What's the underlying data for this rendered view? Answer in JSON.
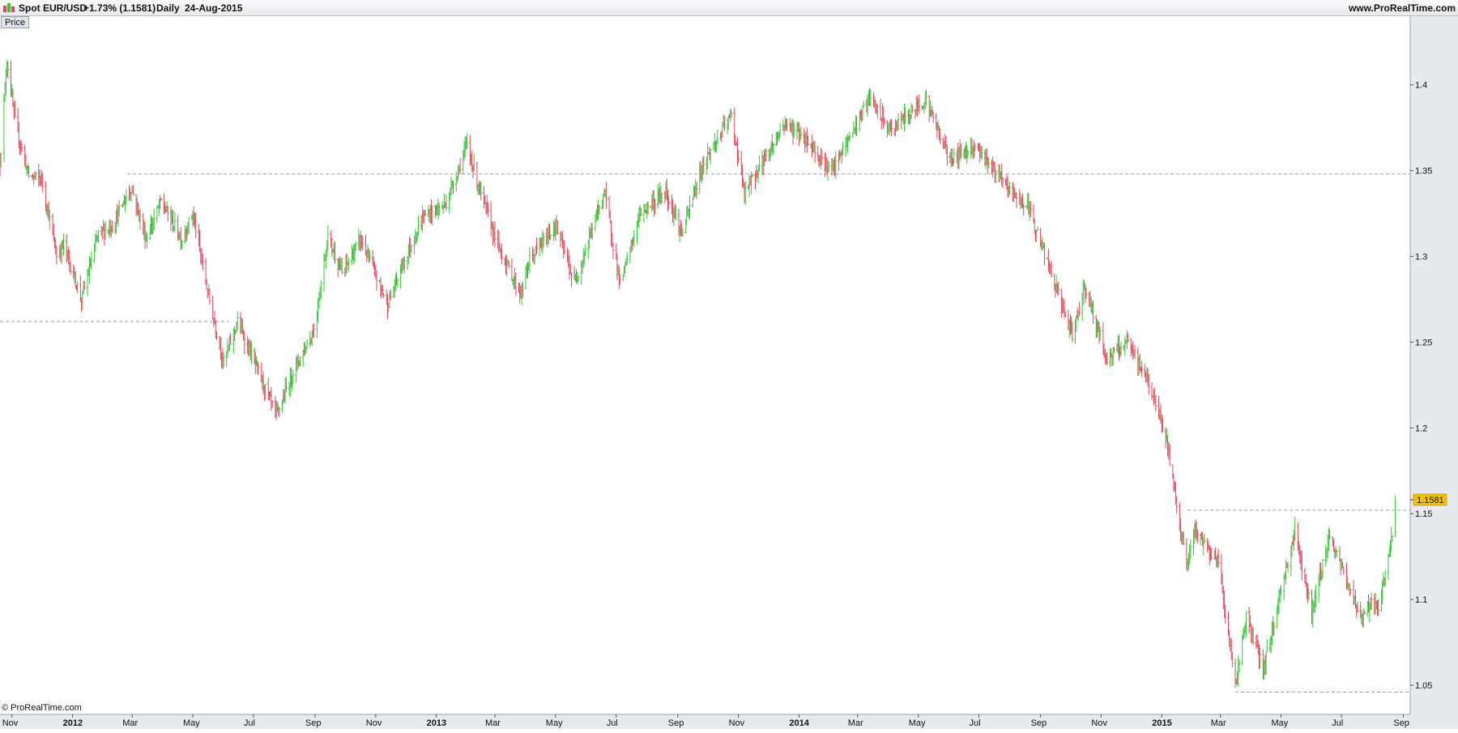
{
  "header": {
    "symbol": "Spot EUR/USD",
    "change": "+1.73% (1.1581)",
    "period": "Daily",
    "date": "24-Aug-2015",
    "brand": "www.ProRealTime.com",
    "panel_label": "Price",
    "copyright": "© ProRealTime.com"
  },
  "colors": {
    "up": "#38c438",
    "down": "#e0485a",
    "last_price_bg": "#f2c200",
    "axis_bg": "#e6e9ee",
    "level_line": "#9a9a9a"
  },
  "chart_data": {
    "type": "ohlc",
    "ylim": [
      1.033,
      1.44
    ],
    "x_range": [
      "2011-10-20",
      "2015-09-08"
    ],
    "y_ticks": [
      "1.05",
      "1.1",
      "1.15",
      "1.2",
      "1.25",
      "1.3",
      "1.35",
      "1.4"
    ],
    "x_ticks": [
      {
        "date": "2011-11-01",
        "label": "Nov",
        "bold": false
      },
      {
        "date": "2012-01-01",
        "label": "2012",
        "bold": true
      },
      {
        "date": "2012-03-01",
        "label": "Mar",
        "bold": false
      },
      {
        "date": "2012-05-01",
        "label": "May",
        "bold": false
      },
      {
        "date": "2012-07-01",
        "label": "Jul",
        "bold": false
      },
      {
        "date": "2012-09-01",
        "label": "Sep",
        "bold": false
      },
      {
        "date": "2012-11-01",
        "label": "Nov",
        "bold": false
      },
      {
        "date": "2013-01-01",
        "label": "2013",
        "bold": true
      },
      {
        "date": "2013-03-01",
        "label": "Mar",
        "bold": false
      },
      {
        "date": "2013-05-01",
        "label": "May",
        "bold": false
      },
      {
        "date": "2013-07-01",
        "label": "Jul",
        "bold": false
      },
      {
        "date": "2013-09-01",
        "label": "Sep",
        "bold": false
      },
      {
        "date": "2013-11-01",
        "label": "Nov",
        "bold": false
      },
      {
        "date": "2014-01-01",
        "label": "2014",
        "bold": true
      },
      {
        "date": "2014-03-01",
        "label": "Mar",
        "bold": false
      },
      {
        "date": "2014-05-01",
        "label": "May",
        "bold": false
      },
      {
        "date": "2014-07-01",
        "label": "Jul",
        "bold": false
      },
      {
        "date": "2014-09-01",
        "label": "Sep",
        "bold": false
      },
      {
        "date": "2014-11-01",
        "label": "Nov",
        "bold": false
      },
      {
        "date": "2015-01-01",
        "label": "2015",
        "bold": true
      },
      {
        "date": "2015-03-01",
        "label": "Mar",
        "bold": false
      },
      {
        "date": "2015-05-01",
        "label": "May",
        "bold": false
      },
      {
        "date": "2015-07-01",
        "label": "Jul",
        "bold": false
      },
      {
        "date": "2015-09-01",
        "label": "Sep",
        "bold": false
      }
    ],
    "path": [
      [
        "2011-10-20",
        1.355
      ],
      [
        "2011-10-27",
        1.415
      ],
      [
        "2011-11-04",
        1.378
      ],
      [
        "2011-11-18",
        1.347
      ],
      [
        "2011-12-01",
        1.345
      ],
      [
        "2011-12-16",
        1.3
      ],
      [
        "2011-12-23",
        1.307
      ],
      [
        "2012-01-10",
        1.275
      ],
      [
        "2012-01-27",
        1.313
      ],
      [
        "2012-02-10",
        1.318
      ],
      [
        "2012-02-29",
        1.34
      ],
      [
        "2012-03-15",
        1.31
      ],
      [
        "2012-03-30",
        1.332
      ],
      [
        "2012-04-20",
        1.31
      ],
      [
        "2012-05-01",
        1.325
      ],
      [
        "2012-05-15",
        1.282
      ],
      [
        "2012-06-01",
        1.238
      ],
      [
        "2012-06-15",
        1.262
      ],
      [
        "2012-06-27",
        1.245
      ],
      [
        "2012-07-24",
        1.207
      ],
      [
        "2012-08-10",
        1.233
      ],
      [
        "2012-08-31",
        1.257
      ],
      [
        "2012-09-14",
        1.312
      ],
      [
        "2012-09-28",
        1.29
      ],
      [
        "2012-10-17",
        1.31
      ],
      [
        "2012-11-13",
        1.272
      ],
      [
        "2012-11-30",
        1.298
      ],
      [
        "2012-12-19",
        1.323
      ],
      [
        "2013-01-10",
        1.33
      ],
      [
        "2013-02-01",
        1.365
      ],
      [
        "2013-02-15",
        1.336
      ],
      [
        "2013-03-05",
        1.305
      ],
      [
        "2013-03-27",
        1.278
      ],
      [
        "2013-04-05",
        1.298
      ],
      [
        "2013-05-01",
        1.318
      ],
      [
        "2013-05-20",
        1.284
      ],
      [
        "2013-06-19",
        1.338
      ],
      [
        "2013-07-05",
        1.283
      ],
      [
        "2013-07-25",
        1.325
      ],
      [
        "2013-08-20",
        1.338
      ],
      [
        "2013-09-05",
        1.313
      ],
      [
        "2013-09-27",
        1.355
      ],
      [
        "2013-10-25",
        1.382
      ],
      [
        "2013-11-07",
        1.336
      ],
      [
        "2013-11-20",
        1.35
      ],
      [
        "2013-12-18",
        1.378
      ],
      [
        "2014-01-10",
        1.367
      ],
      [
        "2014-02-03",
        1.349
      ],
      [
        "2014-03-13",
        1.392
      ],
      [
        "2014-04-03",
        1.373
      ],
      [
        "2014-05-08",
        1.392
      ],
      [
        "2014-05-30",
        1.36
      ],
      [
        "2014-06-06",
        1.358
      ],
      [
        "2014-06-27",
        1.365
      ],
      [
        "2014-07-31",
        1.339
      ],
      [
        "2014-08-20",
        1.328
      ],
      [
        "2014-09-10",
        1.293
      ],
      [
        "2014-10-03",
        1.253
      ],
      [
        "2014-10-15",
        1.283
      ],
      [
        "2014-11-07",
        1.24
      ],
      [
        "2014-11-27",
        1.25
      ],
      [
        "2014-12-20",
        1.225
      ],
      [
        "2015-01-06",
        1.192
      ],
      [
        "2015-01-26",
        1.12
      ],
      [
        "2015-02-03",
        1.14
      ],
      [
        "2015-02-27",
        1.122
      ],
      [
        "2015-03-16",
        1.05
      ],
      [
        "2015-03-27",
        1.09
      ],
      [
        "2015-04-13",
        1.059
      ],
      [
        "2015-05-15",
        1.14
      ],
      [
        "2015-06-01",
        1.092
      ],
      [
        "2015-06-18",
        1.137
      ],
      [
        "2015-07-20",
        1.09
      ],
      [
        "2015-07-31",
        1.098
      ],
      [
        "2015-08-07",
        1.093
      ],
      [
        "2015-08-21",
        1.138
      ],
      [
        "2015-08-24",
        1.158
      ]
    ],
    "levels": [
      {
        "value": 1.348,
        "from": "2012-02-25",
        "to": "2015-09-08"
      },
      {
        "value": 1.262,
        "from": "2011-10-20",
        "to": "2012-06-06"
      },
      {
        "value": 1.152,
        "from": "2015-01-27",
        "to": "2015-09-08"
      },
      {
        "value": 1.046,
        "from": "2015-03-16",
        "to": "2015-09-08"
      }
    ],
    "last_price": "1.1581",
    "last_value": 1.1581
  }
}
